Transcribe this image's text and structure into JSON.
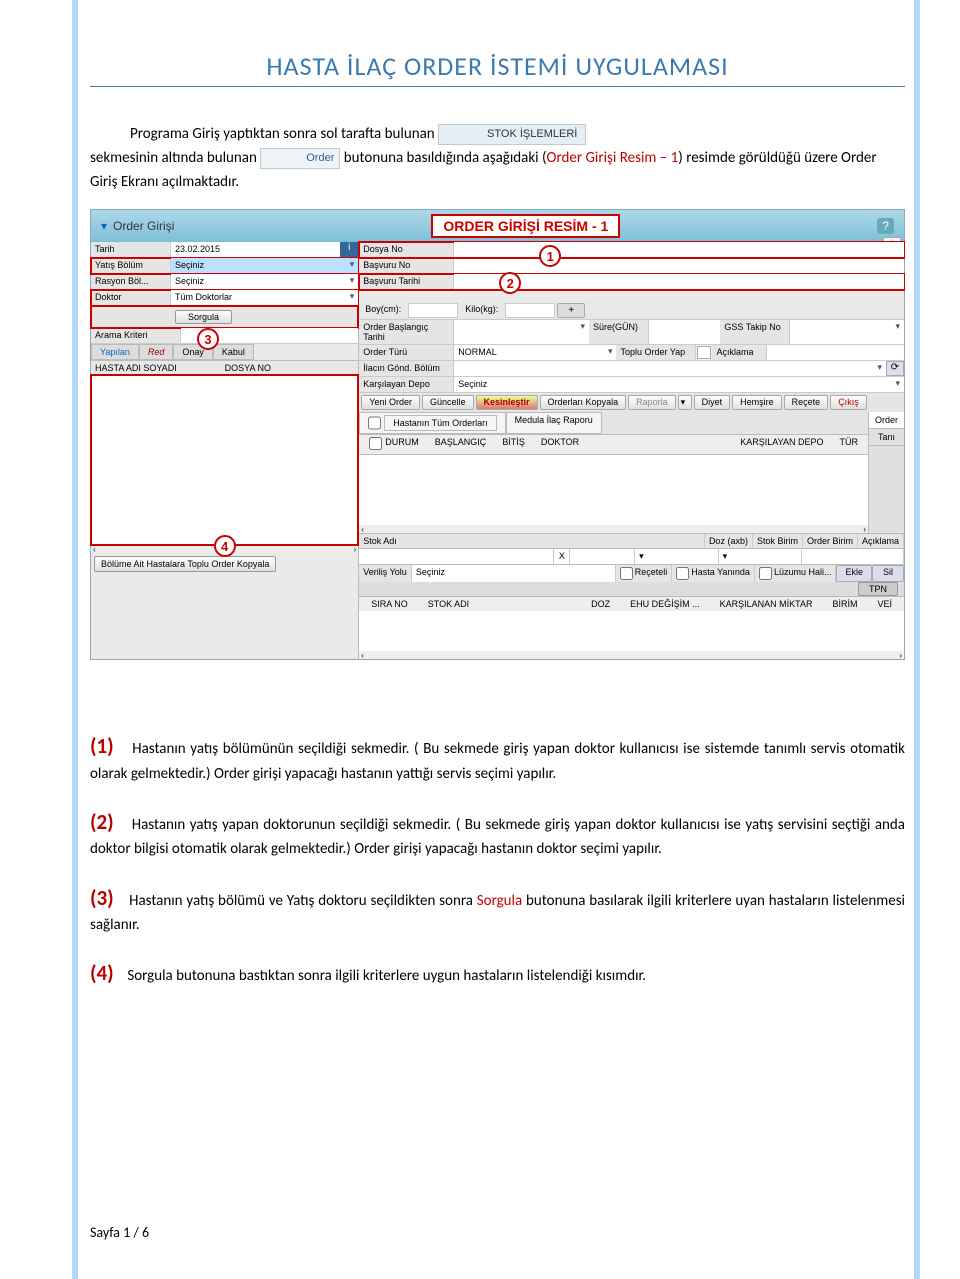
{
  "doc": {
    "title": "HASTA İLAÇ ORDER İSTEMİ UYGULAMASI",
    "footer": "Sayfa 1 / 6"
  },
  "intro": {
    "p1a": "Programa Giriş yaptıktan sonra sol tarafta bulunan ",
    "stok_label": "STOK İŞLEMLERİ",
    "p1b": "sekmesinin altında bulunan ",
    "order_label": "Order",
    "p1c": " butonuna basıldığında aşağıdaki (",
    "resim_ref": "Order Girişi Resim – 1",
    "p1d": ") resimde görüldüğü üzere Order Giriş Ekranı açılmaktadır."
  },
  "screenshot": {
    "window_title": "Order Girişi",
    "banner": "ORDER GİRİŞİ RESİM - 1",
    "left": {
      "tarih_label": "Tarih",
      "tarih_value": "23.02.2015",
      "yatis_label": "Yatış Bölüm",
      "yatis_value": "Seçiniz",
      "rasyon_label": "Rasyon Böl...",
      "rasyon_value": "Seçiniz",
      "doktor_label": "Doktor",
      "doktor_value": "Tüm Doktorlar",
      "sorgula": "Sorgula",
      "arama_kriteri": "Arama Kriteri",
      "tabs": {
        "yapilan": "Yapılan",
        "red": "Red",
        "onay": "Onay",
        "kabul": "Kabul"
      },
      "col1": "HASTA ADI SOYADI",
      "col2": "DOSYA NO",
      "bottom_btn": "Bölüme Ait Hastalara Toplu Order Kopyala"
    },
    "right": {
      "dosya_no": "Dosya No",
      "basvuru_no": "Başvuru No",
      "basvuru_tarihi": "Başvuru Tarihi",
      "boy": "Boy(cm):",
      "kilo": "Kilo(kg):",
      "plus": "+",
      "order_baslangic": "Order Başlangıç Tarihi",
      "sure": "Süre(GÜN)",
      "gss": "GSS Takip No",
      "order_turu": "Order Türü",
      "order_turu_val": "NORMAL",
      "toplu": "Toplu Order Yap",
      "aciklama": "Açıklama",
      "ilacin": "İlacın Gönd. Bölüm",
      "karsilayan": "Karşılayan Depo",
      "karsilayan_val": "Seçiniz",
      "btns": {
        "yeni": "Yeni Order",
        "guncelle": "Güncelle",
        "kesinlestir": "Kesinleştir",
        "kopyala": "Orderları Kopyala",
        "raporla": "Raporla",
        "diyet": "Diyet",
        "hemsire": "Hemşire",
        "recete": "Reçete",
        "cikis": "Çıkış"
      },
      "tab1": "Hastanın Tüm Orderları",
      "tab2": "Medula İlaç Raporu",
      "side_order": "Order",
      "side_tani": "Tanı",
      "cols": {
        "durum": "DURUM",
        "baslangic": "BAŞLANGIÇ",
        "bitis": "BİTİŞ",
        "doktor": "DOKTOR",
        "kdepo": "KARŞILAYAN DEPO",
        "tur": "TÜR"
      },
      "stok_adi": "Stok Adı",
      "doz": "Doz (axb)",
      "sbirim": "Stok Birim",
      "obirim": "Order Birim",
      "acik": "Açıklama",
      "x": "X",
      "verilis": "Veriliş Yolu",
      "verilis_val": "Seçiniz",
      "receteli": "Reçeteli",
      "hasta_yaninda": "Hasta Yanında",
      "luzumu": "Lüzumu Hali...",
      "ekle": "Ekle",
      "sil": "Sil",
      "tpn": "TPN",
      "bcols": {
        "sira": "SIRA NO",
        "stok": "STOK ADI",
        "doz": "DOZ",
        "ehu": "EHU DEĞİŞİM ...",
        "kmiktar": "KARŞILANAN MİKTAR",
        "birim": "BİRİM",
        "vei": "VEİ"
      }
    }
  },
  "notes": {
    "n1a": "Hastanın yatış bölümünün seçildiği sekmedir. ( Bu sekmede giriş yapan doktor kullanıcısı ise sistemde tanımlı servis otomatik olarak gelmektedir.)  Order girişi yapacağı hastanın yattığı servis seçimi yapılır.",
    "n2a": "Hastanın yatış yapan doktorunun seçildiği sekmedir. ( Bu sekmede giriş yapan doktor kullanıcısı ise yatış servisini seçtiği anda doktor bilgisi otomatik olarak gelmektedir.)  Order girişi yapacağı hastanın doktor seçimi yapılır.",
    "n3a": "Hastanın yatış bölümü ve Yatış doktoru seçildikten sonra ",
    "n3b": "Sorgula",
    "n3c": " butonuna basılarak ilgili kriterlere uyan hastaların listelenmesi sağlanır.",
    "n4a": "Sorgula butonuna bastıktan sonra ilgili kriterlere uygun hastaların listelendiği kısımdır."
  }
}
